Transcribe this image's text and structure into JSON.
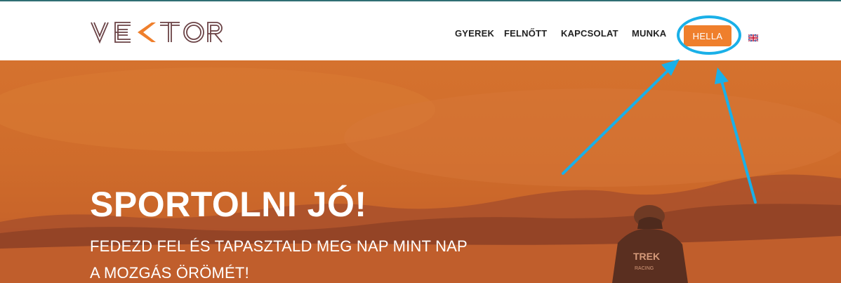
{
  "brand": {
    "logo_text": "VE<TOR"
  },
  "nav": {
    "items": [
      {
        "label": "GYEREK"
      },
      {
        "label": "FELNŐTT"
      },
      {
        "label": "KAPCSOLAT"
      },
      {
        "label": "MUNKA"
      }
    ],
    "cta_label": "HELLA",
    "language_icon": "uk-flag-icon"
  },
  "hero": {
    "title": "SPORTOLNI JÓ!",
    "subtitle_line1": "FEDEZD FEL ÉS TAPASZTALD MEG NAP MINT NAP",
    "subtitle_line2": "A MOZGÁS ÖRÖMÉT!",
    "shirt_text_1": "TREK",
    "shirt_text_2": "RACING"
  },
  "colors": {
    "accent": "#ef7f2c",
    "annotation": "#1ab0e8",
    "logo": "#6b4346",
    "hero_tint": "#cf6c2b"
  }
}
